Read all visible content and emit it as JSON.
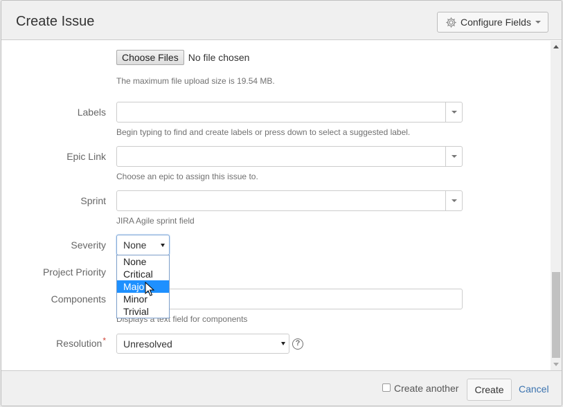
{
  "dialog": {
    "title": "Create Issue",
    "configure_fields_label": "Configure Fields"
  },
  "attachment": {
    "choose_files_label": "Choose Files",
    "file_status": "No file chosen",
    "description": "The maximum file upload size is 19.54 MB."
  },
  "fields": {
    "labels": {
      "label": "Labels",
      "value": "",
      "description": "Begin typing to find and create labels or press down to select a suggested label."
    },
    "epic_link": {
      "label": "Epic Link",
      "value": "",
      "description": "Choose an epic to assign this issue to."
    },
    "sprint": {
      "label": "Sprint",
      "value": "",
      "description": "JIRA Agile sprint field"
    },
    "severity": {
      "label": "Severity",
      "selected": "None",
      "options": [
        "None",
        "Critical",
        "Major",
        "Minor",
        "Trivial"
      ],
      "highlighted": "Major"
    },
    "project_priority": {
      "label": "Project Priority"
    },
    "components": {
      "label": "Components",
      "value": "",
      "description": "Displays a text field for components"
    },
    "resolution": {
      "label": "Resolution",
      "required_marker": "*",
      "selected": "Unresolved",
      "help_glyph": "?"
    }
  },
  "footer": {
    "create_another_label": "Create another",
    "create_another_checked": false,
    "create_label": "Create",
    "cancel_label": "Cancel"
  },
  "icons": {
    "configure": "gear-icon",
    "help": "help-icon",
    "pointer": "mouse-cursor-icon"
  },
  "colors": {
    "header_bg": "#f0f0f0",
    "link": "#3b73af",
    "highlight": "#1e90ff",
    "required": "#d04437"
  }
}
